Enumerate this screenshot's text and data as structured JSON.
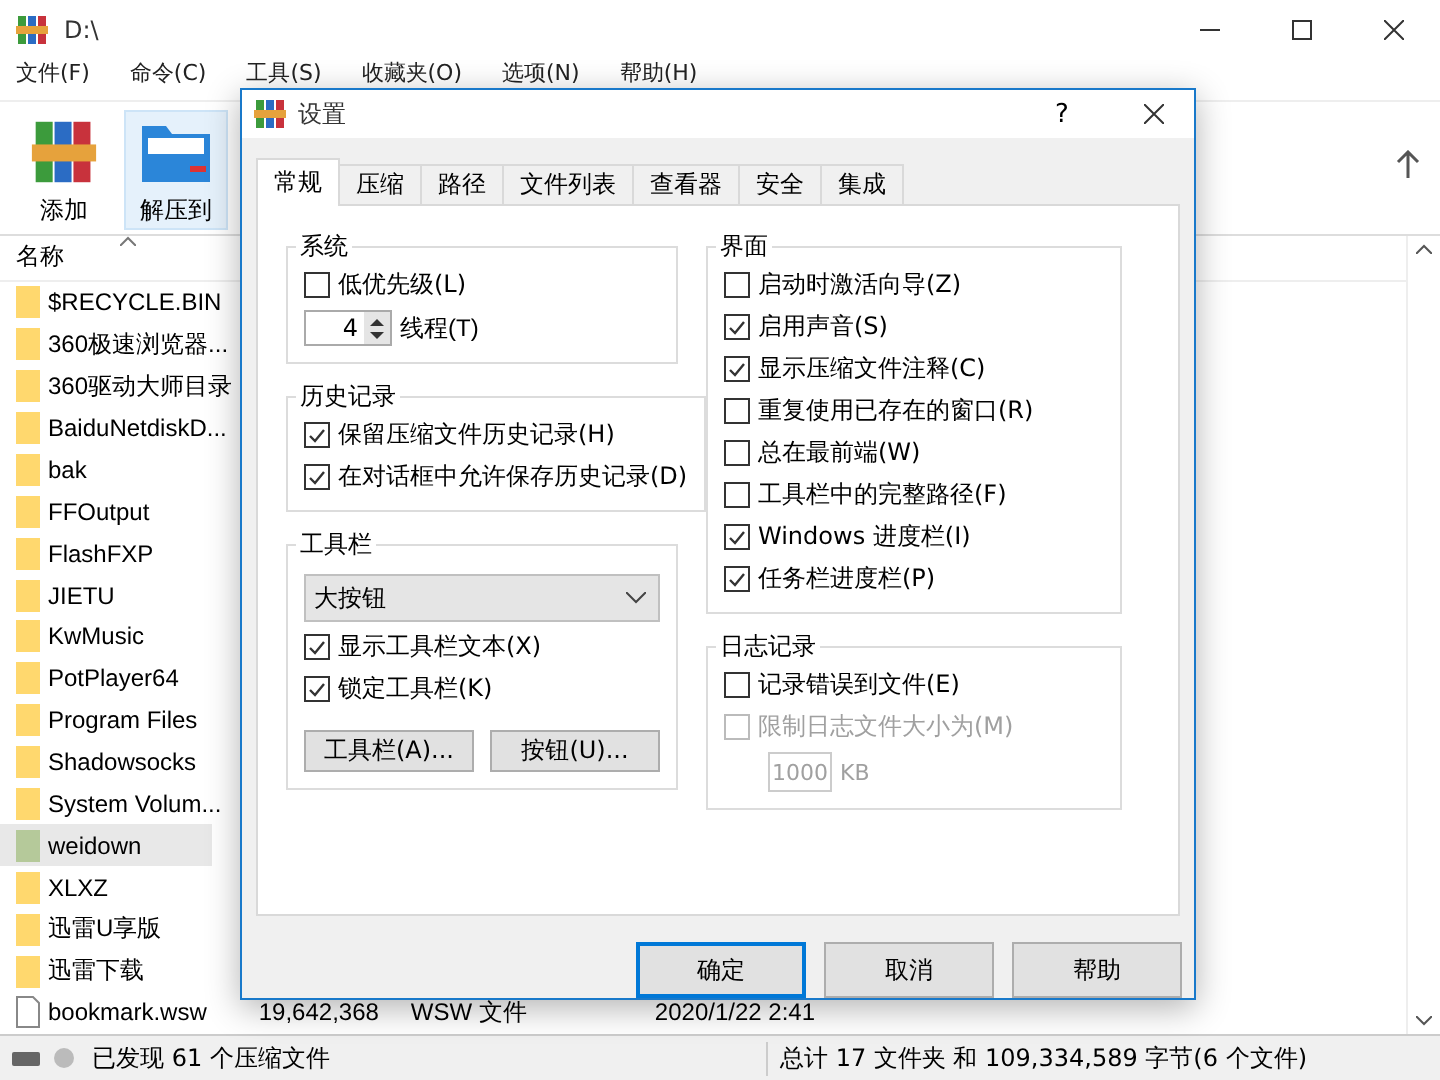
{
  "window": {
    "title": "D:\\"
  },
  "menu": [
    "文件(F)",
    "命令(C)",
    "工具(S)",
    "收藏夹(O)",
    "选项(N)",
    "帮助(H)"
  ],
  "toolbar": [
    {
      "kind": "add",
      "label": "添加"
    },
    {
      "kind": "extract",
      "label": "解压到"
    }
  ],
  "file_list": {
    "column": "名称",
    "rows": [
      {
        "kind": "folder",
        "name": "$RECYCLE.BIN",
        "selected": false
      },
      {
        "kind": "folder",
        "name": "360极速浏览器...",
        "selected": false
      },
      {
        "kind": "folder",
        "name": "360驱动大师目录",
        "selected": false
      },
      {
        "kind": "folder",
        "name": "BaiduNetdiskD...",
        "selected": false
      },
      {
        "kind": "folder",
        "name": "bak",
        "selected": false
      },
      {
        "kind": "folder",
        "name": "FFOutput",
        "selected": false
      },
      {
        "kind": "folder",
        "name": "FlashFXP",
        "selected": false
      },
      {
        "kind": "folder",
        "name": "JIETU",
        "selected": false
      },
      {
        "kind": "folder",
        "name": "KwMusic",
        "selected": false
      },
      {
        "kind": "folder",
        "name": "PotPlayer64",
        "selected": false
      },
      {
        "kind": "folder",
        "name": "Program Files",
        "selected": false
      },
      {
        "kind": "folder",
        "name": "Shadowsocks",
        "selected": false
      },
      {
        "kind": "folder",
        "name": "System Volum...",
        "selected": false
      },
      {
        "kind": "folder",
        "name": "weidown",
        "selected": true
      },
      {
        "kind": "folder",
        "name": "XLXZ",
        "selected": false
      },
      {
        "kind": "folder",
        "name": "迅雷U享版",
        "selected": false
      },
      {
        "kind": "folder",
        "name": "迅雷下载",
        "selected": false
      },
      {
        "kind": "file",
        "name": "bookmark.wsw",
        "size": "19,642,368",
        "type": "WSW 文件",
        "modified": "2020/1/22 2:41",
        "selected": false
      }
    ]
  },
  "status_bar": {
    "left": "已发现 61 个压缩文件",
    "right": "总计 17 文件夹 和 109,334,589 字节(6 个文件)"
  },
  "dialog": {
    "title": "设置",
    "help": "?",
    "tabs": [
      {
        "label": "常规",
        "selected": true
      },
      {
        "label": "压缩",
        "selected": false
      },
      {
        "label": "路径",
        "selected": false
      },
      {
        "label": "文件列表",
        "selected": false
      },
      {
        "label": "查看器",
        "selected": false
      },
      {
        "label": "安全",
        "selected": false
      },
      {
        "label": "集成",
        "selected": false
      }
    ],
    "system": {
      "title": "系统",
      "low_priority": {
        "label": "低优先级(L)",
        "checked": false
      },
      "threads": {
        "value": "4",
        "label": "线程(T)"
      }
    },
    "history": {
      "title": "历史记录",
      "options": [
        {
          "label": "保留压缩文件历史记录(H)",
          "checked": true
        },
        {
          "label": "在对话框中允许保存历史记录(D)",
          "checked": true
        }
      ]
    },
    "toolbar": {
      "title": "工具栏",
      "style": "大按钮",
      "options": [
        {
          "label": "显示工具栏文本(X)",
          "checked": true
        },
        {
          "label": "锁定工具栏(K)",
          "checked": true
        }
      ],
      "buttons": [
        "工具栏(A)...",
        "按钮(U)..."
      ]
    },
    "interface": {
      "title": "界面",
      "options": [
        {
          "label": "启动时激活向导(Z)",
          "checked": false
        },
        {
          "label": "启用声音(S)",
          "checked": true
        },
        {
          "label": "显示压缩文件注释(C)",
          "checked": true
        },
        {
          "label": "重复使用已存在的窗口(R)",
          "checked": false
        },
        {
          "label": "总在最前端(W)",
          "checked": false
        },
        {
          "label": "工具栏中的完整路径(F)",
          "checked": false
        },
        {
          "label": "Windows 进度栏(I)",
          "checked": true
        },
        {
          "label": "任务栏进度栏(P)",
          "checked": true
        }
      ]
    },
    "log": {
      "title": "日志记录",
      "options": [
        {
          "label": "记录错误到文件(E)",
          "checked": false,
          "disabled": false
        },
        {
          "label": "限制日志文件大小为(M)",
          "checked": false,
          "disabled": true
        }
      ],
      "size": {
        "value": "1000",
        "unit": "KB",
        "disabled": true
      }
    },
    "buttons": [
      {
        "label": "确定",
        "default": true
      },
      {
        "label": "取消",
        "default": false
      },
      {
        "label": "帮助",
        "default": false
      }
    ]
  }
}
